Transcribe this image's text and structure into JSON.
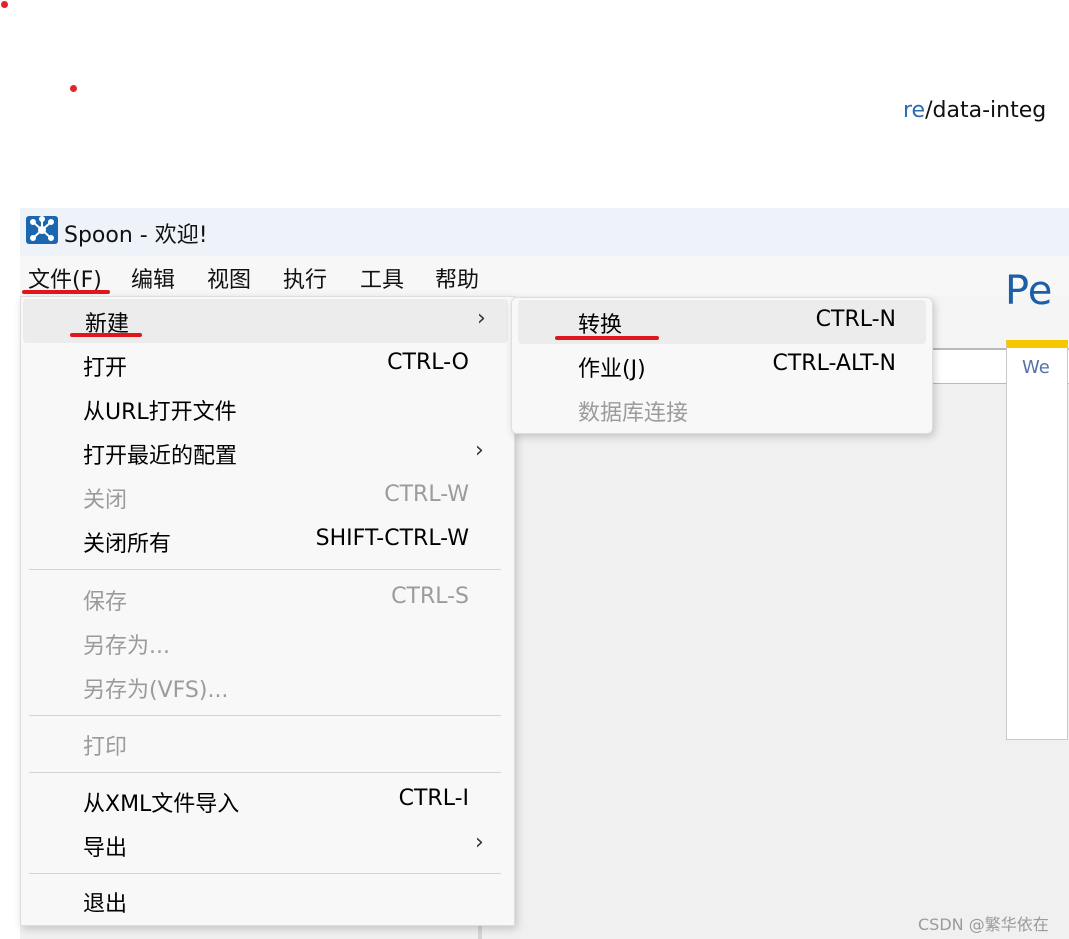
{
  "window": {
    "title": "Spoon - 欢迎!",
    "app_icon": "spoon-app-icon"
  },
  "menubar": {
    "items": [
      "文件(F)",
      "编辑",
      "视图",
      "执行",
      "工具",
      "帮助"
    ]
  },
  "file_menu": {
    "items": [
      {
        "label": "新建",
        "shortcut": "",
        "submenu": true,
        "enabled": true,
        "highlighted": true
      },
      {
        "label": "打开",
        "shortcut": "CTRL-O",
        "submenu": false,
        "enabled": true
      },
      {
        "label": "从URL打开文件",
        "shortcut": "",
        "submenu": false,
        "enabled": true
      },
      {
        "label": "打开最近的配置",
        "shortcut": "",
        "submenu": true,
        "enabled": true
      },
      {
        "label": "关闭",
        "shortcut": "CTRL-W",
        "submenu": false,
        "enabled": false
      },
      {
        "label": "关闭所有",
        "shortcut": "SHIFT-CTRL-W",
        "submenu": false,
        "enabled": true
      },
      {
        "label": "保存",
        "shortcut": "CTRL-S",
        "submenu": false,
        "enabled": false
      },
      {
        "label": "另存为...",
        "shortcut": "",
        "submenu": false,
        "enabled": false
      },
      {
        "label": "另存为(VFS)...",
        "shortcut": "",
        "submenu": false,
        "enabled": false
      },
      {
        "label": "打印",
        "shortcut": "",
        "submenu": false,
        "enabled": false
      },
      {
        "label": "从XML文件导入",
        "shortcut": "CTRL-I",
        "submenu": false,
        "enabled": true
      },
      {
        "label": "导出",
        "shortcut": "",
        "submenu": true,
        "enabled": true
      },
      {
        "label": "退出",
        "shortcut": "",
        "submenu": false,
        "enabled": true
      }
    ],
    "submenu_arrow": "›"
  },
  "new_submenu": {
    "items": [
      {
        "label": "转换",
        "shortcut": "CTRL-N",
        "enabled": true,
        "highlighted": true
      },
      {
        "label": "作业(J)",
        "shortcut": "CTRL-ALT-N",
        "enabled": true
      },
      {
        "label": "数据库连接",
        "shortcut": "",
        "enabled": false
      }
    ]
  },
  "background": {
    "url_fragment_link": "re",
    "url_fragment_rest": "/data-integ",
    "page_title_fragment": "Pe",
    "card_text_fragment": "We"
  },
  "watermark": "CSDN @繁华依在",
  "colors": {
    "annotation_red": "#e0161d",
    "disabled_text": "#9b9b9b",
    "highlight_bg": "#ececec",
    "brand_blue": "#1a66b0",
    "card_accent": "#f6c700"
  }
}
